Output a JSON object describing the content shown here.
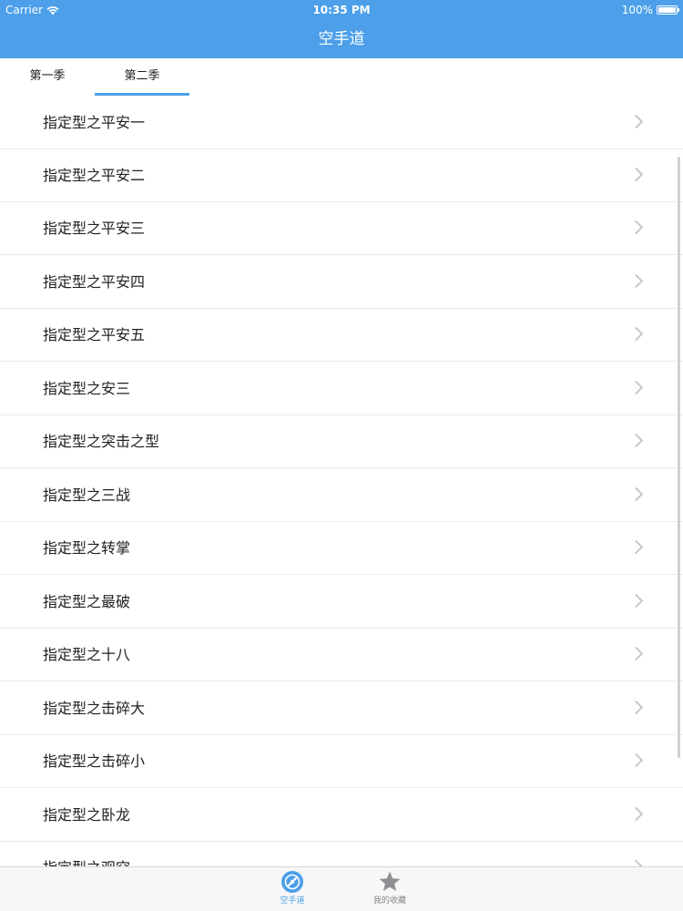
{
  "status_bar": {
    "carrier": "Carrier",
    "time": "10:35 PM",
    "battery": "100%"
  },
  "nav": {
    "title": "空手道"
  },
  "tabs": [
    {
      "label": "第一季",
      "selected": false
    },
    {
      "label": "第二季",
      "selected": true
    }
  ],
  "list": {
    "items": [
      "指定型之平安一",
      "指定型之平安二",
      "指定型之平安三",
      "指定型之平安四",
      "指定型之平安五",
      "指定型之安三",
      "指定型之突击之型",
      "指定型之三战",
      "指定型之转掌",
      "指定型之最破",
      "指定型之十八",
      "指定型之击碎大",
      "指定型之击碎小",
      "指定型之卧龙",
      "指定型之观空"
    ]
  },
  "tabbar": {
    "items": [
      {
        "label": "空手道",
        "icon": "karate-disc-icon",
        "selected": true
      },
      {
        "label": "我的收藏",
        "icon": "star-icon",
        "selected": false
      }
    ]
  },
  "colors": {
    "accent": "#4c9fe8",
    "separator": "#ececec",
    "chevron": "#c7c7cc"
  }
}
